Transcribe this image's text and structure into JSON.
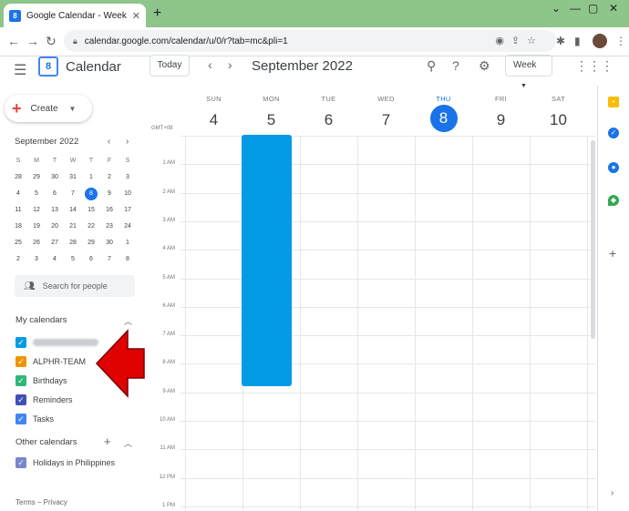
{
  "browser": {
    "tab_title": "Google Calendar - Week of Septe",
    "tab_close": "✕",
    "new_tab": "+",
    "url": "calendar.google.com/calendar/u/0/r?tab=mc&pli=1",
    "win_minimize": "—",
    "win_restore": "▢",
    "win_close": "✕"
  },
  "app": {
    "logo_number": "8",
    "name": "Calendar",
    "today_label": "Today",
    "period_title": "September 2022",
    "view_label": "Week"
  },
  "sidebar": {
    "create_label": "Create",
    "mini_month": "September 2022",
    "mini_dow": [
      "S",
      "M",
      "T",
      "W",
      "T",
      "F",
      "S"
    ],
    "mini_days": [
      "28",
      "29",
      "30",
      "31",
      "1",
      "2",
      "3",
      "4",
      "5",
      "6",
      "7",
      "8",
      "9",
      "10",
      "11",
      "12",
      "13",
      "14",
      "15",
      "16",
      "17",
      "18",
      "19",
      "20",
      "21",
      "22",
      "23",
      "24",
      "25",
      "26",
      "27",
      "28",
      "29",
      "30",
      "1",
      "2",
      "3",
      "4",
      "5",
      "6",
      "7",
      "8"
    ],
    "search_people_placeholder": "Search for people",
    "my_calendars_title": "My calendars",
    "my_calendars": [
      {
        "label": "",
        "color": "#039be5",
        "blurred": true
      },
      {
        "label": "ALPHR-TEAM",
        "color": "#f09300"
      },
      {
        "label": "Birthdays",
        "color": "#33b679"
      },
      {
        "label": "Reminders",
        "color": "#3f51b5"
      },
      {
        "label": "Tasks",
        "color": "#4285f4"
      }
    ],
    "other_calendars_title": "Other calendars",
    "other_calendars": [
      {
        "label": "Holidays in Philippines",
        "color": "#7986cb"
      }
    ],
    "footer": "Terms – Privacy"
  },
  "week": {
    "timezone": "GMT+08",
    "days": [
      {
        "dow": "SUN",
        "num": "4",
        "today": false
      },
      {
        "dow": "MON",
        "num": "5",
        "today": false
      },
      {
        "dow": "TUE",
        "num": "6",
        "today": false
      },
      {
        "dow": "WED",
        "num": "7",
        "today": false
      },
      {
        "dow": "THU",
        "num": "8",
        "today": true
      },
      {
        "dow": "FRI",
        "num": "9",
        "today": false
      },
      {
        "dow": "SAT",
        "num": "10",
        "today": false
      }
    ],
    "hours": [
      "1 AM",
      "2 AM",
      "3 AM",
      "4 AM",
      "5 AM",
      "6 AM",
      "7 AM",
      "8 AM",
      "9 AM",
      "10 AM",
      "11 AM",
      "12 PM",
      "1 PM"
    ],
    "event": {
      "day": "MON",
      "color": "#039be5"
    }
  },
  "colors": {
    "accent": "#1a73e8",
    "chrome_tabbar": "#8ec58a",
    "annotation_arrow": "#e00000"
  }
}
